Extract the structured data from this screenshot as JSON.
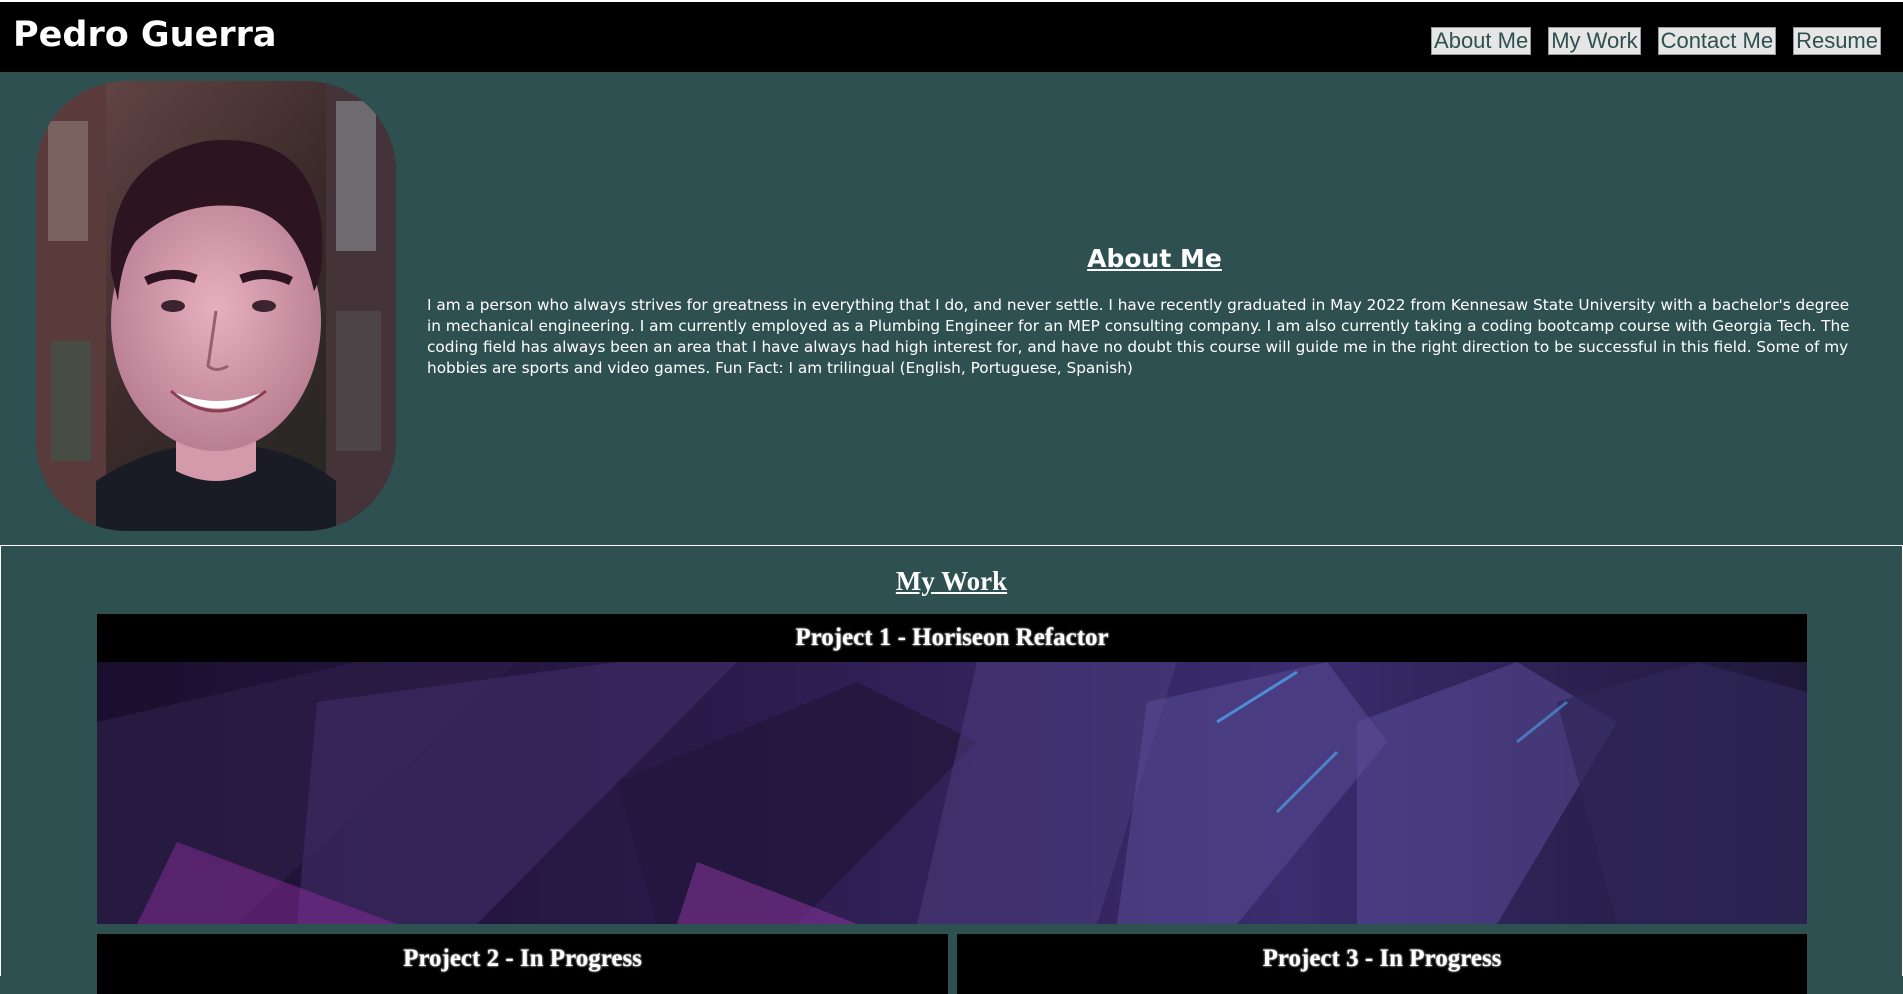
{
  "header": {
    "title": "Pedro Guerra",
    "nav": [
      {
        "label": "About Me"
      },
      {
        "label": "My Work"
      },
      {
        "label": "Contact Me"
      },
      {
        "label": "Resume"
      }
    ]
  },
  "about": {
    "heading": "About Me",
    "body": "I am a person who always strives for greatness in everything that I do, and never settle. I have recently graduated in May 2022 from Kennesaw State University with a bachelor's degree in mechanical engineering. I am currently employed as a Plumbing Engineer for an MEP consulting company. I am also currently taking a coding bootcamp course with Georgia Tech. The coding field has always been an area that I have always had high interest for, and have no doubt this course will guide me in the right direction to be successful in this field. Some of my hobbies are sports and video games. Fun Fact: I am trilingual (English, Portuguese, Spanish)"
  },
  "work": {
    "heading": "My Work",
    "projects": [
      {
        "title": "Project 1 - Horiseon Refactor"
      },
      {
        "title": "Project 2 - In Progress"
      },
      {
        "title": "Project 3 - In Progress"
      }
    ]
  },
  "colors": {
    "background": "#2f5050",
    "header": "#000000",
    "accent_text": "#ffffff",
    "nav_button": "#e6e6e6"
  }
}
